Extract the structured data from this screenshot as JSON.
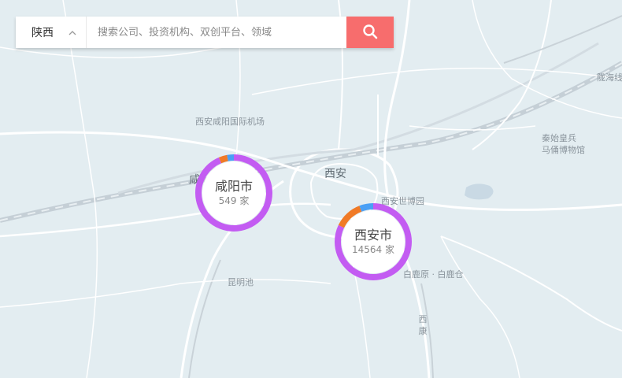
{
  "search": {
    "region": "陕西",
    "placeholder": "搜索公司、投资机构、双创平台、领域",
    "region_icon": "chevron-up-icon",
    "button_icon": "search-icon",
    "button_color": "#f76d6d"
  },
  "map": {
    "background": "#e3edf1",
    "labels": {
      "airport": "西安咸阳国际机场",
      "xian": "西安",
      "xianyang_edge": "咸",
      "expo": "西安世博园",
      "kunming_pond": "昆明池",
      "bailuyuan": "白鹿原 · 白鹿仓",
      "terracotta_1": "秦始皇兵",
      "terracotta_2": "马俑博物馆",
      "xikang": "西康",
      "longhai": "陇海线"
    }
  },
  "cities": [
    {
      "name": "咸阳市",
      "count": "549",
      "unit": "家",
      "segments": [
        {
          "color": "#c35cf2",
          "share": 0.935
        },
        {
          "color": "#f07a26",
          "share": 0.035
        },
        {
          "color": "#4aa0f5",
          "share": 0.03
        }
      ]
    },
    {
      "name": "西安市",
      "count": "14564",
      "unit": "家",
      "segments": [
        {
          "color": "#c35cf2",
          "share": 0.82
        },
        {
          "color": "#f07a26",
          "share": 0.12
        },
        {
          "color": "#4aa0f5",
          "share": 0.06
        }
      ]
    }
  ]
}
